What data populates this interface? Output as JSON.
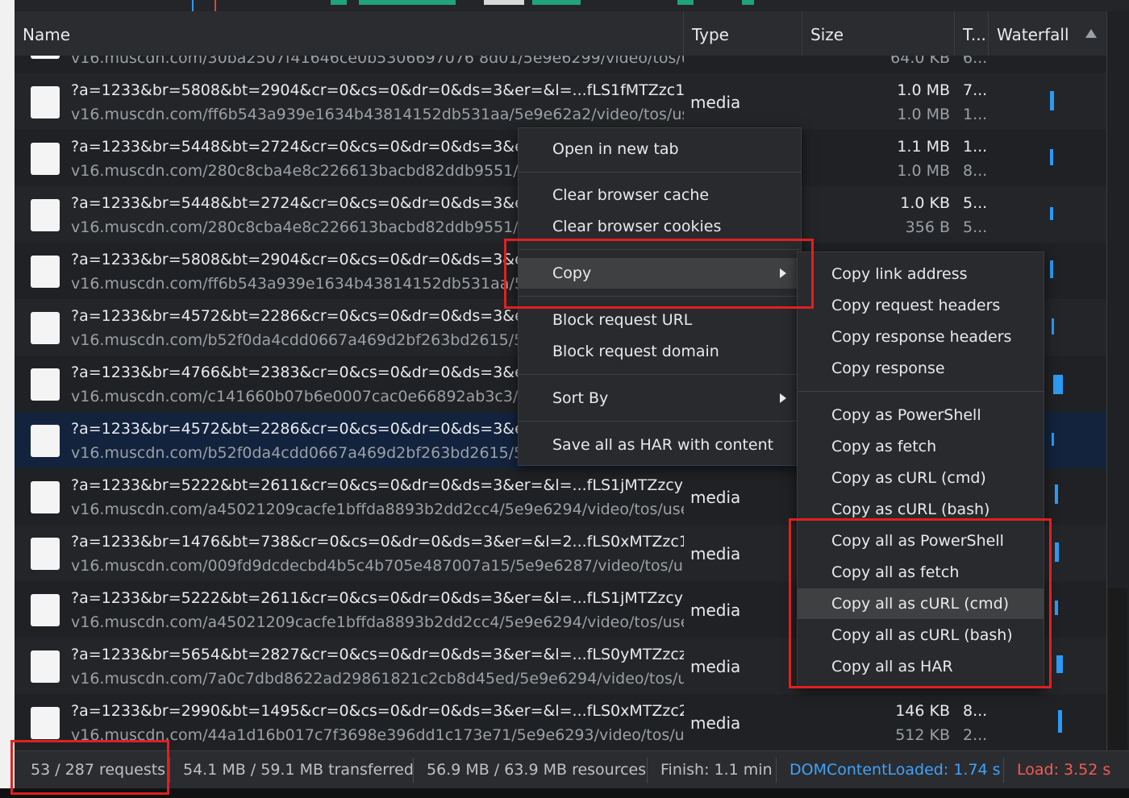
{
  "header": {
    "name": "Name",
    "type": "Type",
    "size": "Size",
    "time": "T...",
    "waterfall": "Waterfall"
  },
  "partial_row": {
    "name2": "v16.muscdn.com/30ba2507f41646ce0b5306697076 8d01/5e9e6299/video/tos/use...",
    "size2": "64.0 KB",
    "t2": "6..."
  },
  "rows": [
    {
      "name1": "?a=1233&br=5808&bt=2904&cr=0&cs=0&dr=0&ds=3&er=&l=...fLS1fMTZzc14...",
      "name2": "v16.muscdn.com/ff6b543a939e1634b43814152db531aa/5e9e62a2/video/tos/use...",
      "type": "media",
      "size1": "1.0 MB",
      "size2": "1.0 MB",
      "t1": "7...",
      "t2": "1..."
    },
    {
      "name1": "?a=1233&br=5448&bt=2724&cr=0&cs=0&dr=0&ds=3&er=",
      "name2": "v16.muscdn.com/280c8cba4e8c226613bacbd82ddb9551/5e9e",
      "type": "",
      "size1": "1.1 MB",
      "size2": "1.0 MB",
      "t1": "1...",
      "t2": "8..."
    },
    {
      "name1": "?a=1233&br=5448&bt=2724&cr=0&cs=0&dr=0&ds=3&er=",
      "name2": "v16.muscdn.com/280c8cba4e8c226613bacbd82ddb9551/5e9e",
      "type": "",
      "size1": "1.0 KB",
      "size2": "356 B",
      "t1": "5...",
      "t2": "5..."
    },
    {
      "name1": "?a=1233&br=5808&bt=2904&cr=0&cs=0&dr=0&ds=3&er=",
      "name2": "v16.muscdn.com/ff6b543a939e1634b43814152db531aa/5e9e",
      "type": "",
      "size1": "",
      "size2": "",
      "t1": "",
      "t2": ""
    },
    {
      "name1": "?a=1233&br=4572&bt=2286&cr=0&cs=0&dr=0&ds=3&er=",
      "name2": "v16.muscdn.com/b52f0da4cdd0667a469d2bf263bd2615/5e9e",
      "type": "",
      "size1": "",
      "size2": "",
      "t1": "",
      "t2": ""
    },
    {
      "name1": "?a=1233&br=4766&bt=2383&cr=0&cs=0&dr=0&ds=3&er=",
      "name2": "v16.muscdn.com/c141660b07b6e0007cac0e66892ab3c3/5e9e",
      "type": "",
      "size1": "",
      "size2": "",
      "t1": "",
      "t2": ""
    },
    {
      "name1": "?a=1233&br=4572&bt=2286&cr=0&cs=0&dr=0&ds=3&er=",
      "name2": "v16.muscdn.com/b52f0da4cdd0667a469d2bf263bd2615/5e9e",
      "type": "",
      "size1": "",
      "size2": "",
      "t1": "",
      "t2": ""
    },
    {
      "name1": "?a=1233&br=5222&bt=2611&cr=0&cs=0&dr=0&ds=3&er=&l=...fLS1jMTZzcy40...",
      "name2": "v16.muscdn.com/a45021209cacfe1bffda8893b2dd2cc4/5e9e6294/video/tos/usea...",
      "type": "media",
      "size1": "",
      "size2": "",
      "t1": "",
      "t2": ""
    },
    {
      "name1": "?a=1233&br=1476&bt=738&cr=0&cs=0&dr=0&ds=3&er=&l=2...fLS0xMTZzc14...",
      "name2": "v16.muscdn.com/009fd9dcdecbd4b5c4b705e487007a15/5e9e6287/video/tos/use...",
      "type": "media",
      "size1": "",
      "size2": "",
      "t1": "",
      "t2": ""
    },
    {
      "name1": "?a=1233&br=5222&bt=2611&cr=0&cs=0&dr=0&ds=3&er=&l=...fLS1jMTZzcy40...",
      "name2": "v16.muscdn.com/a45021209cacfe1bffda8893b2dd2cc4/5e9e6294/video/tos/usea...",
      "type": "media",
      "size1": "",
      "size2": "",
      "t1": "",
      "t2": ""
    },
    {
      "name1": "?a=1233&br=5654&bt=2827&cr=0&cs=0&dr=0&ds=3&er=&l=...fLS0yMTZzczM...",
      "name2": "v16.muscdn.com/7a0c7dbd8622ad29861821c2cb8d45ed/5e9e6294/video/tos/us...",
      "type": "media",
      "size1": "",
      "size2": "",
      "t1": "",
      "t2": ""
    },
    {
      "name1": "?a=1233&br=2990&bt=1495&cr=0&cs=0&dr=0&ds=3&er=&l=...fLS0xMTZzc2J...",
      "name2": "v16.muscdn.com/44a1d16b017c7f3698e396dd1c173e71/5e9e6293/video/tos/use...",
      "type": "media",
      "size1": "146 KB",
      "size2": "512 KB",
      "t1": "8...",
      "t2": "2..."
    }
  ],
  "context_menu": {
    "open_new_tab": "Open in new tab",
    "clear_cache": "Clear browser cache",
    "clear_cookies": "Clear browser cookies",
    "copy": "Copy",
    "block_url": "Block request URL",
    "block_domain": "Block request domain",
    "sort_by": "Sort By",
    "save_har": "Save all as HAR with content"
  },
  "copy_submenu": {
    "link": "Copy link address",
    "req_headers": "Copy request headers",
    "resp_headers": "Copy response headers",
    "response": "Copy response",
    "powershell": "Copy as PowerShell",
    "fetch": "Copy as fetch",
    "curl_cmd": "Copy as cURL (cmd)",
    "curl_bash": "Copy as cURL (bash)",
    "all_powershell": "Copy all as PowerShell",
    "all_fetch": "Copy all as fetch",
    "all_curl_cmd": "Copy all as cURL (cmd)",
    "all_curl_bash": "Copy all as cURL (bash)",
    "all_har": "Copy all as HAR"
  },
  "footer": {
    "requests": "53 / 287 requests",
    "transferred": "54.1 MB / 59.1 MB transferred",
    "resources": "56.9 MB / 63.9 MB resources",
    "finish": "Finish: 1.1 min",
    "dom": "DOMContentLoaded: 1.74 s",
    "load": "Load: 3.52 s"
  },
  "colors": {
    "dom": "#3ea3ff",
    "load": "#f25c54",
    "highlight_box": "#e02020"
  }
}
